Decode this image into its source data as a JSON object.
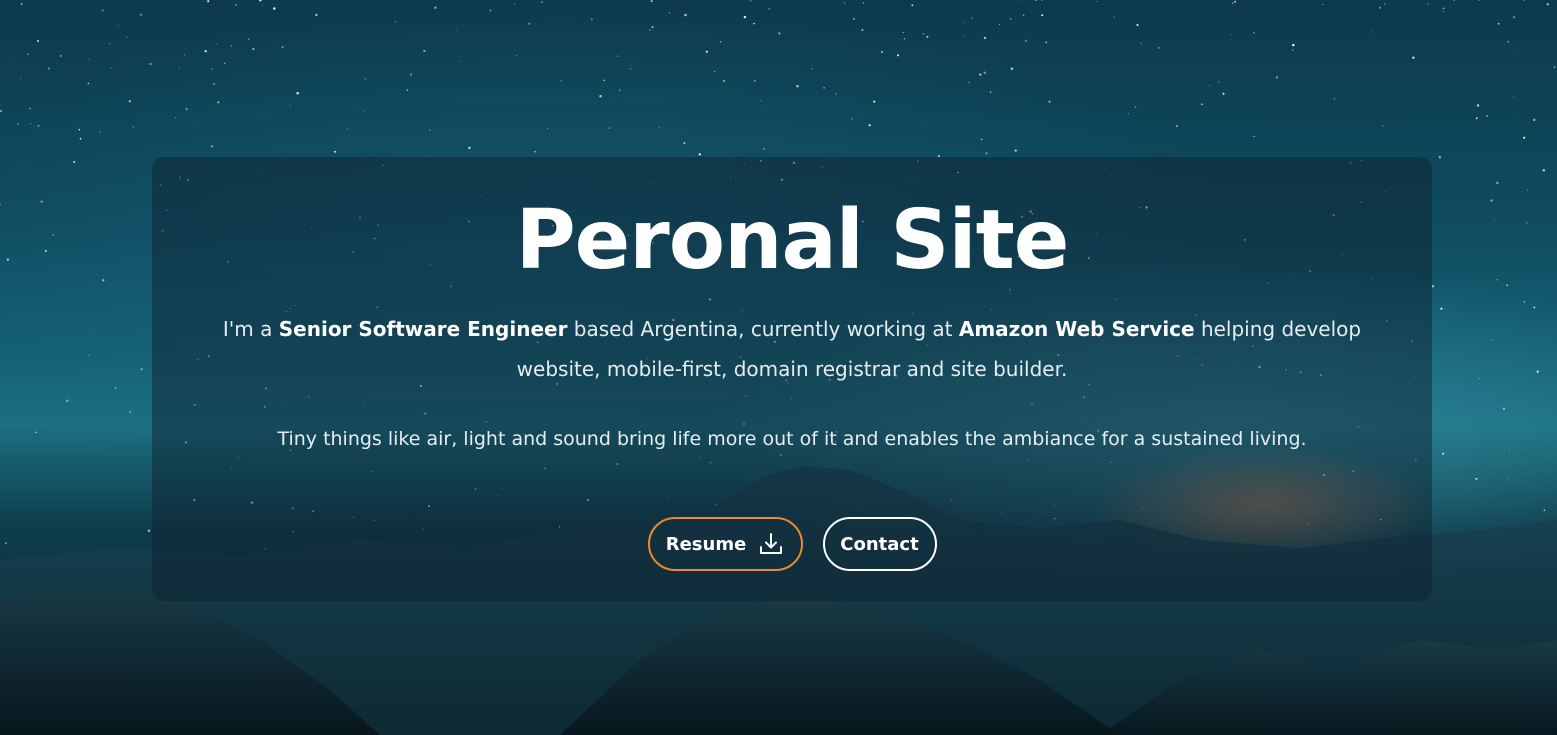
{
  "hero": {
    "title": "Peronal Site",
    "intro": {
      "prefix": "I'm a ",
      "role": "Senior Software Engineer",
      "middle": " based Argentina, currently working at ",
      "company": "Amazon Web Service",
      "suffix": " helping develop website, mobile-first, domain registrar and site builder."
    },
    "tagline": "Tiny things like air, light and sound bring life more out of it and enables the ambiance for a sustained living.",
    "buttons": {
      "resume_label": "Resume",
      "resume_icon": "download-icon",
      "contact_label": "Contact"
    }
  },
  "colors": {
    "accent": "#e98a2f",
    "text": "#ffffff",
    "panel": "#0e2230"
  }
}
